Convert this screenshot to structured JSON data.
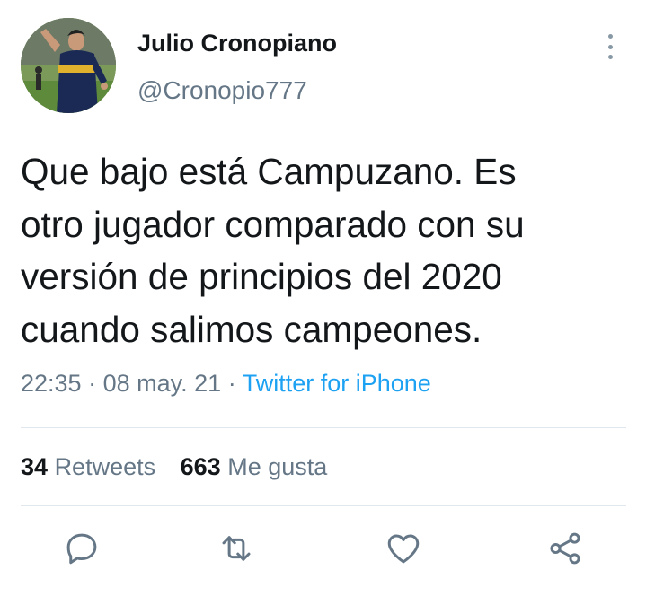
{
  "tweet": {
    "display_name": "Julio Cronopiano",
    "handle": "@Cronopio777",
    "text_lines": [
      "Que bajo está Campuzano. Es",
      "otro jugador comparado con su",
      "versión de principios del 2020",
      "cuando salimos campeones."
    ],
    "time": "22:35",
    "date": "08 may. 21",
    "separator": "·",
    "source": "Twitter for iPhone"
  },
  "stats": {
    "retweets_count": "34",
    "retweets_label": "Retweets",
    "likes_count": "663",
    "likes_label": "Me gusta"
  },
  "actions": {
    "reply_icon": "reply-icon",
    "retweet_icon": "retweet-icon",
    "like_icon": "heart-icon",
    "share_icon": "share-icon"
  },
  "colors": {
    "accent": "#1da1f2",
    "secondary_text": "#657786",
    "primary_text": "#14171a",
    "divider": "#e1e8ed"
  }
}
